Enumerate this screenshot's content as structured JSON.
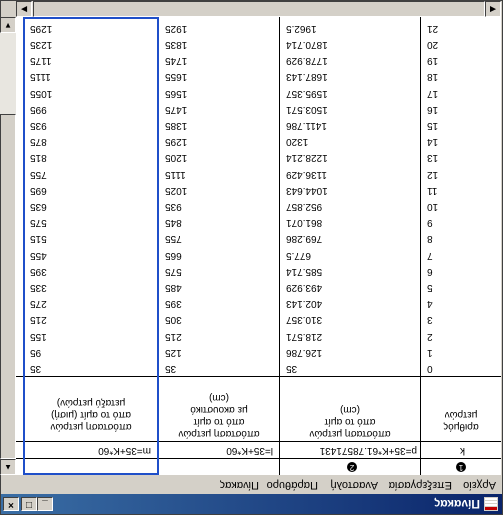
{
  "window": {
    "title": "Πίνακας"
  },
  "menu": [
    "Αρχείο",
    "Επεξεργασία",
    "Αναστολή",
    "Παράθυρο",
    "Πίνακας"
  ],
  "columns": [
    {
      "badge": "1",
      "formula": "k",
      "header": [
        "αριθμός",
        "μετρών"
      ]
    },
    {
      "badge": "2",
      "formula": "p=35+K*61.78571431",
      "header": [
        "απόσταση μετρών",
        "από το αμίτ",
        "(cm)"
      ]
    },
    {
      "badge": "",
      "formula": "l=35+K*60",
      "header": [
        "απόσταση μετρών",
        "από το αμίτ",
        "με ακουστικό",
        "(cm)"
      ]
    },
    {
      "badge": "",
      "formula": "m=35+K*60",
      "header": [
        "απόσταση μετρών",
        "από το αμίτ (μισή)",
        "μεταξύ μετρών)"
      ]
    }
  ],
  "rows": [
    [
      "0",
      "35",
      "35",
      "35"
    ],
    [
      "1",
      "126.786",
      "125",
      "95"
    ],
    [
      "2",
      "218.571",
      "215",
      "155"
    ],
    [
      "3",
      "310.357",
      "305",
      "215"
    ],
    [
      "4",
      "402.143",
      "395",
      "275"
    ],
    [
      "5",
      "493.929",
      "485",
      "335"
    ],
    [
      "6",
      "585.714",
      "575",
      "395"
    ],
    [
      "7",
      "677.5",
      "665",
      "455"
    ],
    [
      "8",
      "769.286",
      "755",
      "515"
    ],
    [
      "9",
      "861.071",
      "845",
      "575"
    ],
    [
      "10",
      "952.857",
      "935",
      "635"
    ],
    [
      "11",
      "1044.643",
      "1025",
      "695"
    ],
    [
      "12",
      "1136.429",
      "1115",
      "755"
    ],
    [
      "13",
      "1228.214",
      "1205",
      "815"
    ],
    [
      "14",
      "1320",
      "1295",
      "875"
    ],
    [
      "15",
      "1411.786",
      "1385",
      "935"
    ],
    [
      "16",
      "1503.571",
      "1475",
      "995"
    ],
    [
      "17",
      "1595.357",
      "1565",
      "1055"
    ],
    [
      "18",
      "1687.143",
      "1655",
      "1115"
    ],
    [
      "19",
      "1778.929",
      "1745",
      "1175"
    ],
    [
      "20",
      "1870.714",
      "1835",
      "1235"
    ],
    [
      "21",
      "1962.5",
      "1925",
      "1295"
    ]
  ]
}
